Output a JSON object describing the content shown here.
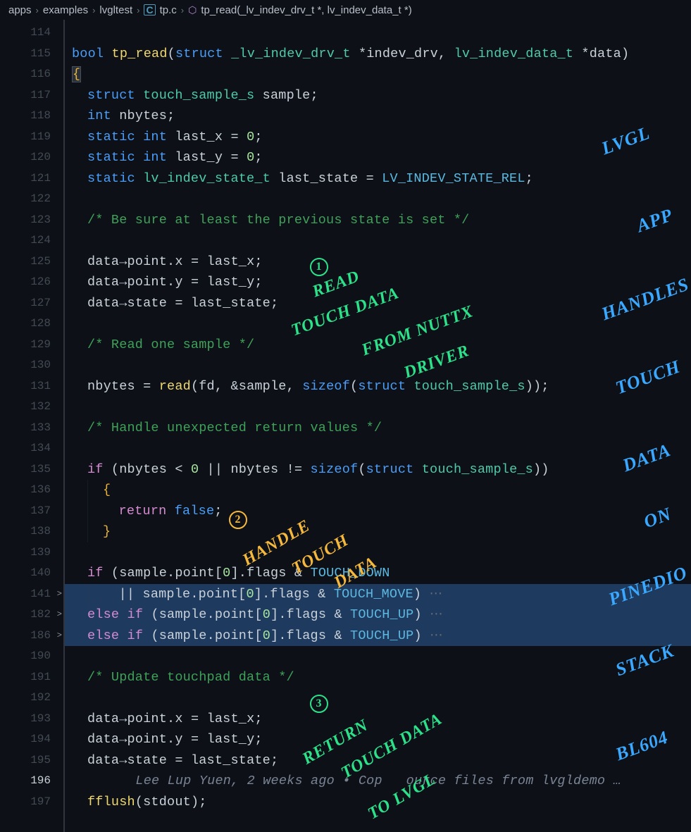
{
  "breadcrumb": {
    "seg1": "apps",
    "seg2": "examples",
    "seg3": "lvgltest",
    "file": "tp.c",
    "symbol": "tp_read(_lv_indev_drv_t *, lv_indev_data_t *)"
  },
  "lines": [
    {
      "n": "114",
      "fold": "",
      "html": ""
    },
    {
      "n": "115",
      "fold": "",
      "html": "<span class='kw'>bool</span> <span class='fn'>tp_read</span>(<span class='kw'>struct</span> <span class='ty'>_lv_indev_drv_t</span> <span class='op'>*</span><span class='va'>indev_drv</span>, <span class='ty'>lv_indev_data_t</span> <span class='op'>*</span><span class='va'>data</span>)"
    },
    {
      "n": "116",
      "fold": "",
      "html": "<span class='pn' style='background:#2a3038;border:1px solid #4a5060'>{</span>"
    },
    {
      "n": "117",
      "fold": "",
      "html": "<span class='indent first'></span><span class='kw'>struct</span> <span class='ty'>touch_sample_s</span> <span class='va'>sample</span>;"
    },
    {
      "n": "118",
      "fold": "",
      "html": "<span class='indent first'></span><span class='kw'>int</span> <span class='va'>nbytes</span>;"
    },
    {
      "n": "119",
      "fold": "",
      "html": "<span class='indent first'></span><span class='kw'>static</span> <span class='kw'>int</span> <span class='va'>last_x</span> = <span class='num'>0</span>;"
    },
    {
      "n": "120",
      "fold": "",
      "html": "<span class='indent first'></span><span class='kw'>static</span> <span class='kw'>int</span> <span class='va'>last_y</span> = <span class='num'>0</span>;"
    },
    {
      "n": "121",
      "fold": "",
      "html": "<span class='indent first'></span><span class='kw'>static</span> <span class='ty'>lv_indev_state_t</span> <span class='va'>last_state</span> = <span class='cn'>LV_INDEV_STATE_REL</span>;"
    },
    {
      "n": "122",
      "fold": "",
      "html": ""
    },
    {
      "n": "123",
      "fold": "",
      "html": "<span class='indent first'></span><span class='cm'>/* Be sure at least the previous state is set */</span>"
    },
    {
      "n": "124",
      "fold": "",
      "html": ""
    },
    {
      "n": "125",
      "fold": "",
      "html": "<span class='indent first'></span><span class='va'>data</span><span class='op'>→</span><span class='va'>point</span>.<span class='va'>x</span> = <span class='va'>last_x</span>;"
    },
    {
      "n": "126",
      "fold": "",
      "html": "<span class='indent first'></span><span class='va'>data</span><span class='op'>→</span><span class='va'>point</span>.<span class='va'>y</span> = <span class='va'>last_y</span>;"
    },
    {
      "n": "127",
      "fold": "",
      "html": "<span class='indent first'></span><span class='va'>data</span><span class='op'>→</span><span class='va'>state</span> = <span class='va'>last_state</span>;"
    },
    {
      "n": "128",
      "fold": "",
      "html": ""
    },
    {
      "n": "129",
      "fold": "",
      "html": "<span class='indent first'></span><span class='cm'>/* Read one sample */</span>"
    },
    {
      "n": "130",
      "fold": "",
      "html": ""
    },
    {
      "n": "131",
      "fold": "",
      "html": "<span class='indent first'></span><span class='va'>nbytes</span> = <span class='fn'>read</span>(<span class='va'>fd</span>, <span class='op'>&amp;</span><span class='va'>sample</span>, <span class='kw'>sizeof</span>(<span class='kw'>struct</span> <span class='ty'>touch_sample_s</span>));"
    },
    {
      "n": "132",
      "fold": "",
      "html": ""
    },
    {
      "n": "133",
      "fold": "",
      "html": "<span class='indent first'></span><span class='cm'>/* Handle unexpected return values */</span>"
    },
    {
      "n": "134",
      "fold": "",
      "html": ""
    },
    {
      "n": "135",
      "fold": "",
      "html": "<span class='indent first'></span><span class='cf'>if</span> (<span class='va'>nbytes</span> &lt; <span class='num'>0</span> || <span class='va'>nbytes</span> != <span class='kw'>sizeof</span>(<span class='kw'>struct</span> <span class='ty'>touch_sample_s</span>))"
    },
    {
      "n": "136",
      "fold": "",
      "html": "<span class='indent first'></span><span class='indent'></span><span class='pn'>{</span>"
    },
    {
      "n": "137",
      "fold": "",
      "html": "<span class='indent first'></span><span class='indent'></span>  <span class='cf'>return</span> <span class='kw'>false</span>;"
    },
    {
      "n": "138",
      "fold": "",
      "html": "<span class='indent first'></span><span class='indent'></span><span class='pn'>}</span>"
    },
    {
      "n": "139",
      "fold": "",
      "html": ""
    },
    {
      "n": "140",
      "fold": "",
      "html": "<span class='indent first'></span><span class='cf'>if</span> (<span class='va'>sample</span>.<span class='va'>point</span>[<span class='num'>0</span>].<span class='va'>flags</span> &amp; <span class='cn'>TOUCH_DOWN</span>"
    },
    {
      "n": "141",
      "fold": ">",
      "hl": true,
      "html": "<span class='indent first'></span><span class='indent'></span>  || <span class='va'>sample</span>.<span class='va'>point</span>[<span class='num'>0</span>].<span class='va'>flags</span> &amp; <span class='cn'>TOUCH_MOVE</span>)<span class='gl'> ⋯</span>"
    },
    {
      "n": "182",
      "fold": ">",
      "hl": true,
      "html": "<span class='indent first'></span><span class='cf'>else</span> <span class='cf'>if</span> (<span class='va'>sample</span>.<span class='va'>point</span>[<span class='num'>0</span>].<span class='va'>flags</span> &amp; <span class='cn'>TOUCH_UP</span>)<span class='gl'> ⋯</span>"
    },
    {
      "n": "186",
      "fold": ">",
      "hl": true,
      "html": "<span class='indent first'></span><span class='cf'>else</span> <span class='cf'>if</span> (<span class='va'>sample</span>.<span class='va'>point</span>[<span class='num'>0</span>].<span class='va'>flags</span> &amp; <span class='cn'>TOUCH_UP</span>)<span class='gl'> ⋯</span>"
    },
    {
      "n": "190",
      "fold": "",
      "html": ""
    },
    {
      "n": "191",
      "fold": "",
      "html": "<span class='indent first'></span><span class='cm'>/* Update touchpad data */</span>"
    },
    {
      "n": "192",
      "fold": "",
      "html": ""
    },
    {
      "n": "193",
      "fold": "",
      "html": "<span class='indent first'></span><span class='va'>data</span><span class='op'>→</span><span class='va'>point</span>.<span class='va'>x</span> = <span class='va'>last_x</span>;"
    },
    {
      "n": "194",
      "fold": "",
      "html": "<span class='indent first'></span><span class='va'>data</span><span class='op'>→</span><span class='va'>point</span>.<span class='va'>y</span> = <span class='va'>last_y</span>;"
    },
    {
      "n": "195",
      "fold": "",
      "html": "<span class='indent first'></span><span class='va'>data</span><span class='op'>→</span><span class='va'>state</span> = <span class='va'>last_state</span>;"
    },
    {
      "n": "196",
      "fold": "",
      "active": true,
      "html": "        <span class='bl'>Lee Lup Yuen, 2 weeks ago • Cop&nbsp;&nbsp;&nbsp;ource files from lvgldemo …</span>"
    },
    {
      "n": "197",
      "fold": "",
      "html": "<span class='indent first'></span><span class='fn'>fflush</span>(<span class='va'>stdout</span>);"
    }
  ],
  "annotations": {
    "green1_circle": "1",
    "green1_l1": "READ",
    "green1_l2": "TOUCH DATA",
    "green1_l3": "FROM NUTTX",
    "green1_l4": "DRIVER",
    "yellow_circle": "2",
    "yellow_l1": "HANDLE",
    "yellow_l2": "TOUCH",
    "yellow_l3": "DATA",
    "green3_circle": "3",
    "green3_l1": "RETURN",
    "green3_l2": "TOUCH DATA",
    "green3_l3": "TO LVGL",
    "blue_l1": "LVGL",
    "blue_l2": "APP",
    "blue_l3": "HANDLES",
    "blue_l4": "TOUCH",
    "blue_l5": "DATA",
    "blue_l6": "ON",
    "blue_l7": "PINEDIO",
    "blue_l8": "STACK",
    "blue_l9": "BL604"
  }
}
